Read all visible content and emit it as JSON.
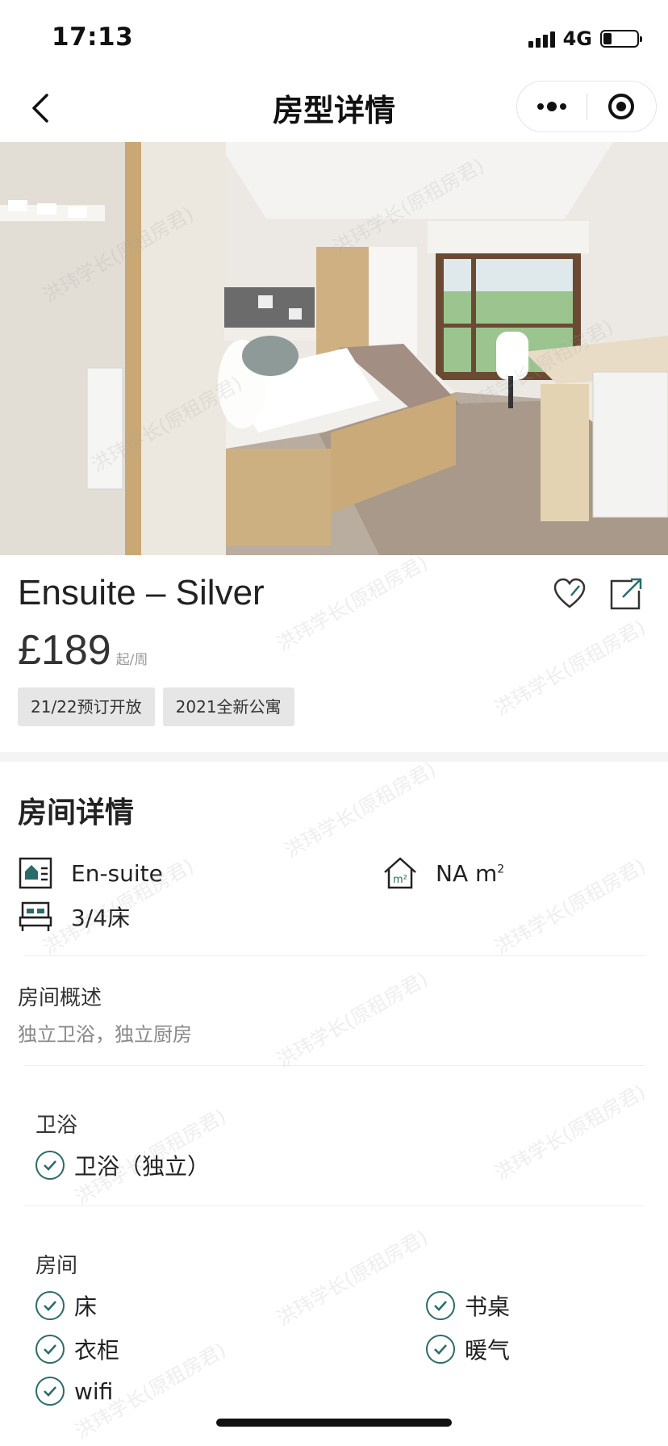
{
  "status_bar": {
    "time": "17:13",
    "network": "4G"
  },
  "nav": {
    "title": "房型详情"
  },
  "room": {
    "name": "Ensuite – Silver",
    "price": "£189",
    "price_unit": "起/周",
    "tags": [
      "21/22预订开放",
      "2021全新公寓"
    ]
  },
  "details": {
    "section_title": "房间详情",
    "room_type": "En-suite",
    "area_value": "NA m",
    "area_sup": "2",
    "beds": "3/4床",
    "overview_label": "房间概述",
    "overview_text": "独立卫浴，独立厨房",
    "bathroom": {
      "label": "卫浴",
      "items": [
        "卫浴（独立）"
      ]
    },
    "room_features": {
      "label": "房间",
      "items": [
        "床",
        "书桌",
        "衣柜",
        "暖气",
        "wifi"
      ]
    }
  },
  "watermark": "洪玮学长(原租房君)",
  "colors": {
    "accent": "#2a6b6b",
    "tag_bg": "#e6e6e6"
  }
}
